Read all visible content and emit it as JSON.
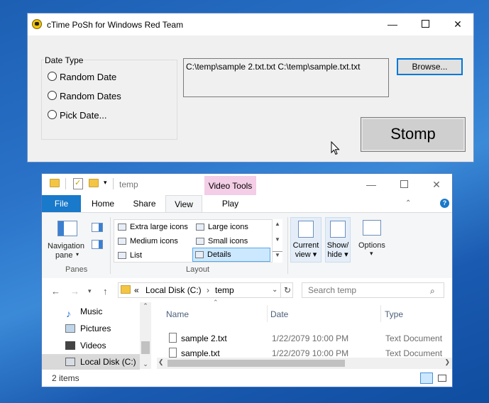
{
  "ctime": {
    "title": "cTime PoSh for Windows Red Team",
    "group_title": "Date Type",
    "radios": [
      "Random Date",
      "Random Dates",
      "Pick Date..."
    ],
    "path_text": "C:\\temp\\sample 2.txt.txt C:\\temp\\sample.txt.txt",
    "browse_label": "Browse...",
    "stomp_label": "Stomp"
  },
  "explorer": {
    "title": "temp",
    "context_tab": "Video Tools",
    "tabs": {
      "file": "File",
      "home": "Home",
      "share": "Share",
      "view": "View",
      "play": "Play"
    },
    "ribbon": {
      "nav_pane_label_1": "Navigation",
      "nav_pane_label_2": "pane",
      "panes_group": "Panes",
      "layout_items": [
        "Extra large icons",
        "Large icons",
        "Medium icons",
        "Small icons",
        "List",
        "Details"
      ],
      "layout_group": "Layout",
      "current_view_1": "Current",
      "current_view_2": "view",
      "show_hide_1": "Show/",
      "show_hide_2": "hide",
      "options": "Options"
    },
    "address": {
      "prefix": "«",
      "segments": [
        "Local Disk (C:)",
        "temp"
      ]
    },
    "search_placeholder": "Search temp",
    "nav_items": [
      "Music",
      "Pictures",
      "Videos",
      "Local Disk (C:)"
    ],
    "columns": [
      "Name",
      "Date",
      "Type"
    ],
    "files": [
      {
        "name": "sample 2.txt",
        "date": "1/22/2079 10:00 PM",
        "type": "Text Document"
      },
      {
        "name": "sample.txt",
        "date": "1/22/2079 10:00 PM",
        "type": "Text Document"
      }
    ],
    "status": "2 items"
  }
}
